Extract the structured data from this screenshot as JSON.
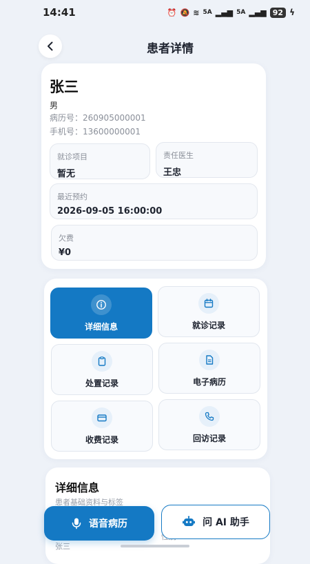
{
  "status_bar": {
    "time": "14:41",
    "sig1": "5A",
    "sig2": "5A",
    "battery": "92"
  },
  "header": {
    "title": "患者详情"
  },
  "patient": {
    "name": "张三",
    "gender": "男",
    "record_label": "病历号：",
    "record_number": "260905000001",
    "phone_label": "手机号：",
    "phone_number": "13600000001",
    "project_label": "就诊项目",
    "project_value": "暂无",
    "doctor_label": "责任医生",
    "doctor_value": "王忠",
    "appointment_label": "最近预约",
    "appointment_value": "2026-09-05 16:00:00",
    "debt_label": "欠费",
    "debt_value": "¥0"
  },
  "menu": {
    "details": "详细信息",
    "visits": "就诊记录",
    "treatments": "处置记录",
    "emr": "电子病历",
    "billing": "收费记录",
    "followups": "回访记录"
  },
  "detail_section": {
    "title": "详细信息",
    "subtitle": "患者基础资料与标签",
    "peek_a": "张三",
    "peek_b": "性别"
  },
  "actions": {
    "voice": "语音病历",
    "ai": "问 AI 助手"
  },
  "colors": {
    "accent": "#1479c4",
    "background": "#eef2f8"
  }
}
